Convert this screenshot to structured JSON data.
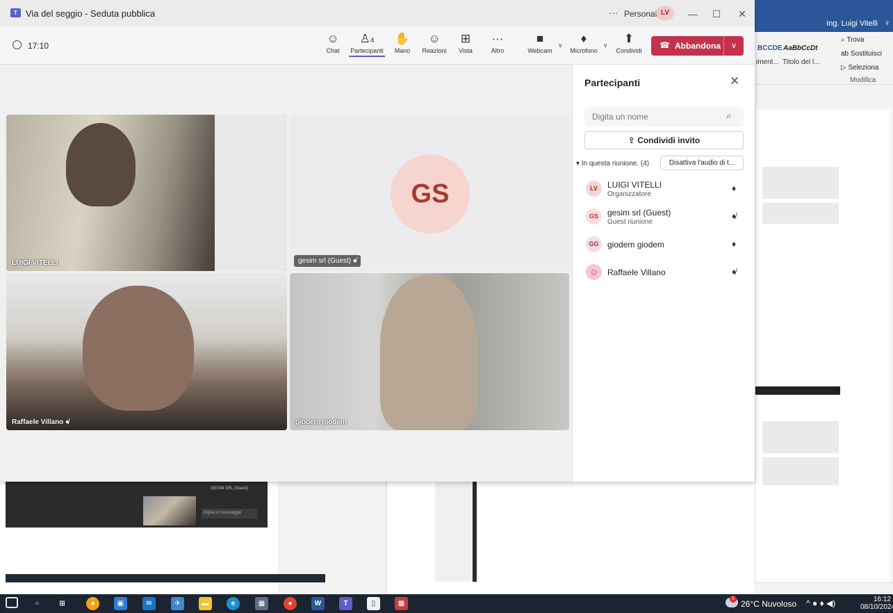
{
  "teams": {
    "window_title": "Via del seggio - Seduta pubblica",
    "title_more": "···",
    "profile_label": "Personale",
    "profile_initials": "LV",
    "timer": "17:10",
    "toolbar": {
      "chat": "Chat",
      "participants": "Partecipanti",
      "participants_count": "4",
      "hand": "Mano",
      "reactions": "Reazioni",
      "view": "Vista",
      "more": "Altro",
      "webcam": "Webcam",
      "mic": "Microfono",
      "share": "Condividi",
      "leave": "Abbandona"
    },
    "tiles": [
      {
        "name": "LUIGI VITELLI"
      },
      {
        "name": "gesim srl (Guest)",
        "initials": "GS"
      },
      {
        "name": "Raffaele Villano"
      },
      {
        "name": "giodem giodem"
      }
    ],
    "panel": {
      "title": "Partecipanti",
      "search_placeholder": "Digita un nome",
      "invite_label": "Condividi invito",
      "section_label": "In questa riunione. (4)",
      "mute_all_label": "Disattiva l'audio di t...",
      "participants": [
        {
          "initials": "LV",
          "name": "LUIGI VITELLI",
          "role": "Organizzatore",
          "muted": false,
          "color": "#f4d6d6"
        },
        {
          "initials": "GS",
          "name": "gesim srl (Guest)",
          "role": "Guest riunione",
          "muted": true,
          "color": "#fde0dc"
        },
        {
          "initials": "GG",
          "name": "giodem giodem",
          "role": "",
          "muted": false,
          "color": "#f3dde3"
        },
        {
          "initials": "",
          "name": "Raffaele Villano",
          "role": "",
          "muted": true,
          "color": "#f6c6d6"
        }
      ]
    }
  },
  "word": {
    "user": "Ing. Luigi Vitelli",
    "styles": [
      "BCCDE",
      "AaBbCcDt"
    ],
    "style_labels": [
      "iment...",
      "Titolo del l..."
    ],
    "find": "Trova",
    "replace": "Sostituisci",
    "select": "Seleziona",
    "group": "Modifica"
  },
  "background": {
    "chat_input": "Digita un messaggio",
    "chat_user": "GESIM SRL (Guest)"
  },
  "taskbar": {
    "weather": "26°C Nuvoloso",
    "badge": "1",
    "time": "16:12",
    "date": "08/10/2024"
  },
  "colors": {
    "teams_accent": "#5b5fc7",
    "leave_red": "#c4314b",
    "word_blue": "#2b579a",
    "taskbar": "#1b2430"
  }
}
